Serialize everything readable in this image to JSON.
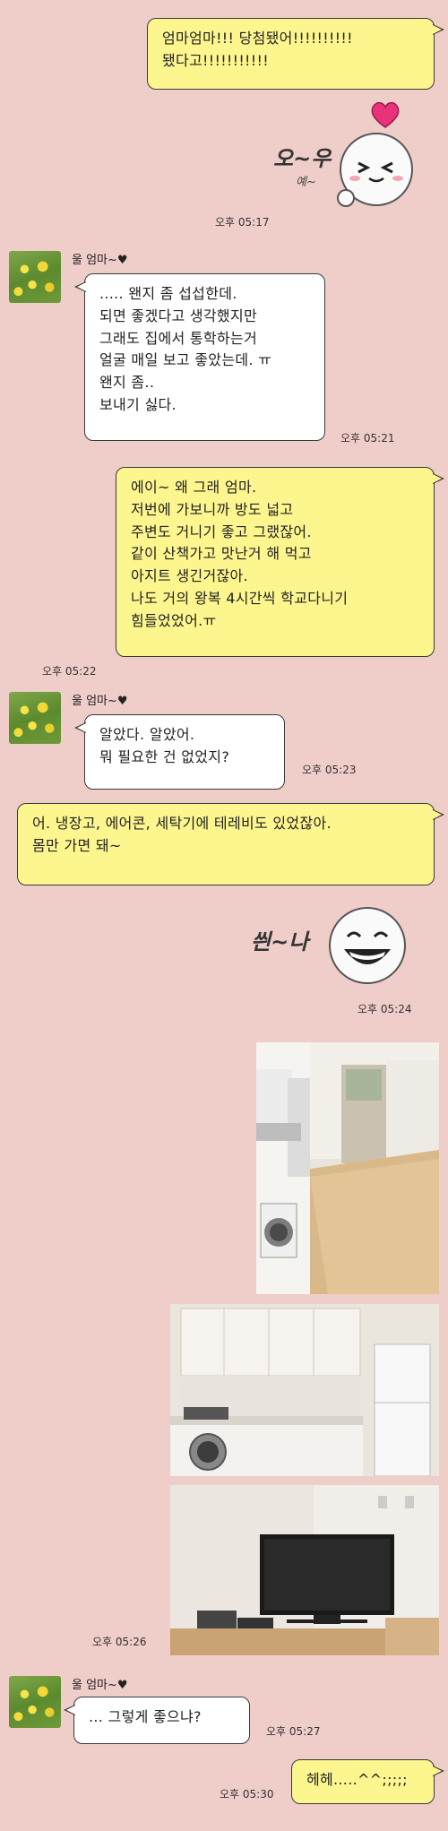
{
  "messages": {
    "m1": "엄마엄마!!! 당첨됐어!!!!!!!!!!\n됐다고!!!!!!!!!!!",
    "m1_time": "오후 05:17",
    "sticker1_text": "오~우",
    "sticker1_sub": "예~",
    "m2_sender": "울 엄마~♥",
    "m2": "..... 왠지 좀 섭섭한데.\n되면 좋겠다고 생각했지만\n그래도 집에서 통학하는거\n얼굴 매일 보고 좋았는데. ㅠ\n왠지 좀..\n보내기 싫다.",
    "m2_time": "오후 05:21",
    "m3": "에이~ 왜 그래 엄마.\n저번에 가보니까 방도 넓고\n주변도 거니기 좋고 그랬잖어.\n같이 산책가고 맛난거 해 먹고\n아지트 생긴거잖아.\n나도 거의 왕복 4시간씩 학교다니기\n힘들었었어.ㅠ",
    "m3_time": "오후 05:22",
    "m4_sender": "울 엄마~♥",
    "m4": "알았다. 알았어.\n뭐 필요한 건 없었지?",
    "m4_time": "오후 05:23",
    "m5": "어. 냉장고, 에어콘, 세탁기에 테레비도 있었잖아.\n몸만 가면 돼~",
    "sticker2_text": "씐~나",
    "m5_time": "오후 05:24",
    "photos_time": "오후 05:26",
    "m6_sender": "울 엄마~♥",
    "m6": "... 그렇게 좋으냐?",
    "m6_time": "오후 05:27",
    "m7": "헤헤.....^^;;;;;",
    "m7_time": "오후 05:30"
  },
  "colors": {
    "background": "#efcdc9",
    "my_bubble": "#fdf68f",
    "their_bubble": "#ffffff"
  }
}
